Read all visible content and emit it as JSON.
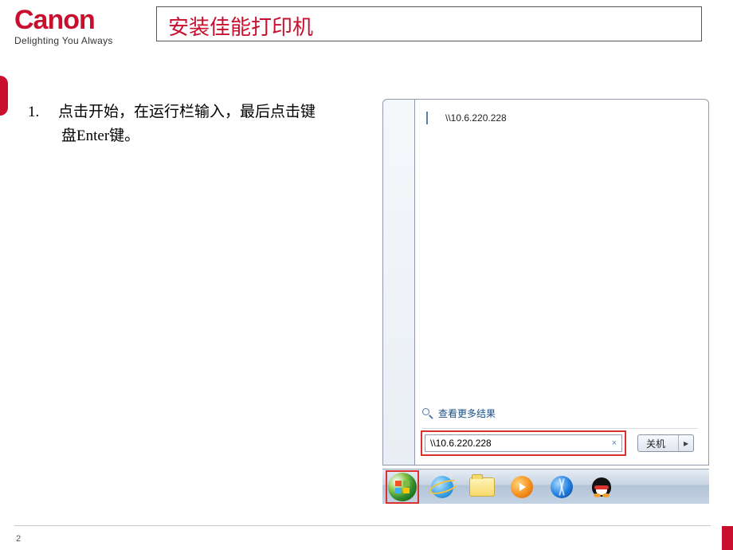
{
  "logo": {
    "text": "Canon",
    "tagline": "Delighting You Always"
  },
  "title": "安装佳能打印机",
  "instruction": {
    "num": "1.",
    "line1": "点击开始，在运行栏输入，最后点击键",
    "line2": "盘Enter键。"
  },
  "start_menu": {
    "result": "\\\\10.6.220.228",
    "see_more": "查看更多结果",
    "search_value": "\\\\10.6.220.228",
    "clear": "×",
    "shutdown": "关机",
    "arrow": "▶"
  },
  "taskbar": {
    "start": "start-button",
    "icons": [
      "ie",
      "explorer",
      "wmp",
      "blue-app",
      "qq"
    ]
  },
  "page_number": "2"
}
